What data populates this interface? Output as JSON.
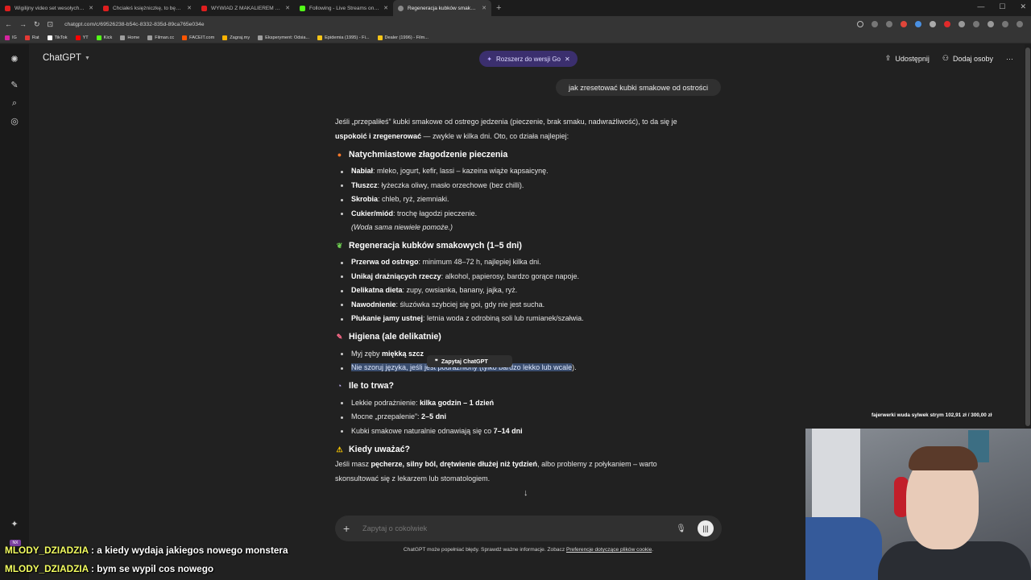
{
  "browser": {
    "tabs": [
      {
        "title": "Wigilijny video set wesołych świąt ko",
        "color": "#e01e1e",
        "active": false
      },
      {
        "title": "Chciałeś księżniczkę, to będziesz mi",
        "color": "#e01e1e",
        "active": false
      },
      {
        "title": "WYWIAD Z MAKALIEREM - najlepsz",
        "color": "#e01e1e",
        "active": false
      },
      {
        "title": "Following - Live Streams on Kick",
        "color": "#53fc18",
        "active": false
      },
      {
        "title": "Regeneracja kubków smakowych",
        "color": "#8a8a8a",
        "active": true
      }
    ],
    "url": "chatgpt.com/c/69526238-b54c-8332-835d-89ca765e034e",
    "bookmarks": [
      {
        "label": "IG",
        "color": "#d6249f"
      },
      {
        "label": "Rat",
        "color": "#e53935"
      },
      {
        "label": "TikTok",
        "color": "#ffffff"
      },
      {
        "label": "YT",
        "color": "#ff0000"
      },
      {
        "label": "Kick",
        "color": "#53fc18"
      },
      {
        "label": "Home",
        "color": "#9e9e9e"
      },
      {
        "label": "Filman.cc",
        "color": "#9e9e9e"
      },
      {
        "label": "FACEIT.com",
        "color": "#ff5500"
      },
      {
        "label": "Zagraj.my",
        "color": "#ffb300"
      },
      {
        "label": "Eksperyment: Odsia...",
        "color": "#9e9e9e"
      },
      {
        "label": "Epidemia (1995) - Fi...",
        "color": "#f5c518"
      },
      {
        "label": "Dealer (1996) - Film...",
        "color": "#f5c518"
      }
    ]
  },
  "app": {
    "brand": "ChatGPT",
    "promo": "Rozszerz do wersji Go",
    "share": "Udostępnij",
    "add_people": "Dodaj osoby",
    "more": "···"
  },
  "user_message": "jak zresetować kubki smakowe od ostrości",
  "answer": {
    "intro_1": "Jeśli „przepaliłeś” kubki smakowe od ostrego jedzenia (pieczenie, brak smaku, nadwrażliwość), to da się je",
    "intro_2_bold": "uspokoić i zregenerować",
    "intro_2_rest": " — zwykle w kilka dni. Oto, co działa najlepiej:",
    "s1_title": "Natychmiastowe złagodzenie pieczenia",
    "s1_items": [
      {
        "bold": "Nabiał",
        "rest": ": mleko, jogurt, kefir, lassi – kazeina wiąże kapsaicynę."
      },
      {
        "bold": "Tłuszcz",
        "rest": ": łyżeczka oliwy, masło orzechowe (bez chilli)."
      },
      {
        "bold": "Skrobia",
        "rest": ": chleb, ryż, ziemniaki."
      },
      {
        "bold": "Cukier/miód",
        "rest": ": trochę łagodzi pieczenie."
      }
    ],
    "s1_note": "(Woda sama niewiele pomoże.)",
    "s2_title": "Regeneracja kubków smakowych (1–5 dni)",
    "s2_items": [
      {
        "bold": "Przerwa od ostrego",
        "rest": ": minimum 48–72 h, najlepiej kilka dni."
      },
      {
        "bold": "Unikaj drażniących rzeczy",
        "rest": ": alkohol, papierosy, bardzo gorące napoje."
      },
      {
        "bold": "Delikatna dieta",
        "rest": ": zupy, owsianka, banany, jajka, ryż."
      },
      {
        "bold": "Nawodnienie",
        "rest": ": śluzówka szybciej się goi, gdy nie jest sucha."
      },
      {
        "bold": "Płukanie jamy ustnej",
        "rest": ": letnia woda z odrobiną soli lub rumianek/szałwia."
      }
    ],
    "s3_title": "Higiena (ale delikatnie)",
    "s3_item1_pre": "Myj zęby ",
    "s3_item1_bold": "miękką szcz",
    "s3_item2": "Nie szoruj języka, jeśli jest podrażniony (tylko bardzo lekko lub wcale",
    "s3_item2_end": ").",
    "tooltip": "Zapytaj ChatGPT",
    "s4_title": "Ile to trwa?",
    "s4_items": [
      {
        "pre": "Lekkie podrażnienie: ",
        "bold": "kilka godzin – 1 dzień"
      },
      {
        "pre": "Mocne „przepalenie”: ",
        "bold": "2–5 dni"
      },
      {
        "pre": "Kubki smakowe naturalnie odnawiają się co ",
        "bold": "7–14 dni"
      }
    ],
    "s5_title": "Kiedy uważać?",
    "s5_pre": "Jeśli masz ",
    "s5_bold": "pęcherze, silny ból, drętwienie dłużej niż tydzień",
    "s5_rest": ", albo problemy z połykaniem – warto",
    "s5_line2": "skonsultować się z lekarzem lub stomatologiem."
  },
  "composer": {
    "placeholder": "Zapytaj o cokolwiek"
  },
  "disclaimer": {
    "text": "ChatGPT może popełniać błędy. Sprawdź ważne informacje. Zobacz ",
    "link": "Preferencje dotyczące plików cookie",
    "end": "."
  },
  "stream": {
    "donation": "fajerwerki wuda sylwek strym 102,91 zł / 300,00 zł",
    "chat": [
      {
        "user": "MLODY_DZIADZIA",
        "message": " : a kiedy wydaja jakiegos nowego monstera"
      },
      {
        "user": "MLODY_DZIADZIA",
        "message": " : bym se wypil cos nowego"
      }
    ]
  }
}
